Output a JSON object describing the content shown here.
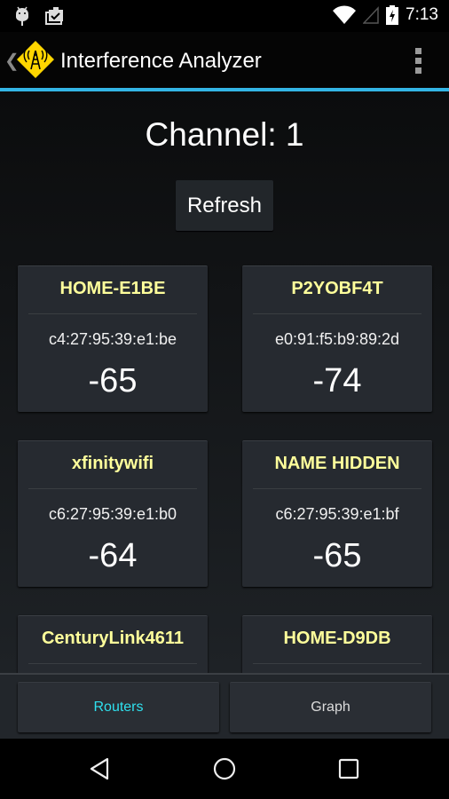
{
  "status_bar": {
    "left_icons": [
      "android-debug-icon",
      "clipboard-check-icon"
    ],
    "right_icons": [
      "wifi-icon",
      "cell-signal-icon",
      "battery-charging-icon"
    ],
    "time": "7:13"
  },
  "action_bar": {
    "title": "Interference Analyzer",
    "back_icon": "chevron-left-icon",
    "app_icon": "radio-tower-warning-icon",
    "overflow_icon": "overflow-menu-icon"
  },
  "main": {
    "channel_label": "Channel: 1",
    "refresh_label": "Refresh",
    "routers": [
      {
        "name": "HOME-E1BE",
        "mac": "c4:27:95:39:e1:be",
        "rssi": "-65"
      },
      {
        "name": "P2YOBF4T",
        "mac": "e0:91:f5:b9:89:2d",
        "rssi": "-74"
      },
      {
        "name": "xfinitywifi",
        "mac": "c6:27:95:39:e1:b0",
        "rssi": "-64"
      },
      {
        "name": "NAME HIDDEN",
        "mac": "c6:27:95:39:e1:bf",
        "rssi": "-65"
      },
      {
        "name": "CenturyLink4611",
        "mac": "",
        "rssi": ""
      },
      {
        "name": "HOME-D9DB",
        "mac": "",
        "rssi": ""
      }
    ]
  },
  "tabs": [
    {
      "label": "Routers",
      "active": true,
      "color": "#2fe0ee"
    },
    {
      "label": "Graph",
      "active": false
    }
  ],
  "nav_bar": {
    "buttons": [
      "back-icon",
      "home-icon",
      "recents-icon"
    ]
  },
  "colors": {
    "accent": "#33b5e5",
    "router_name": "#ffff9b",
    "active_tab": "#2fe0ee"
  }
}
